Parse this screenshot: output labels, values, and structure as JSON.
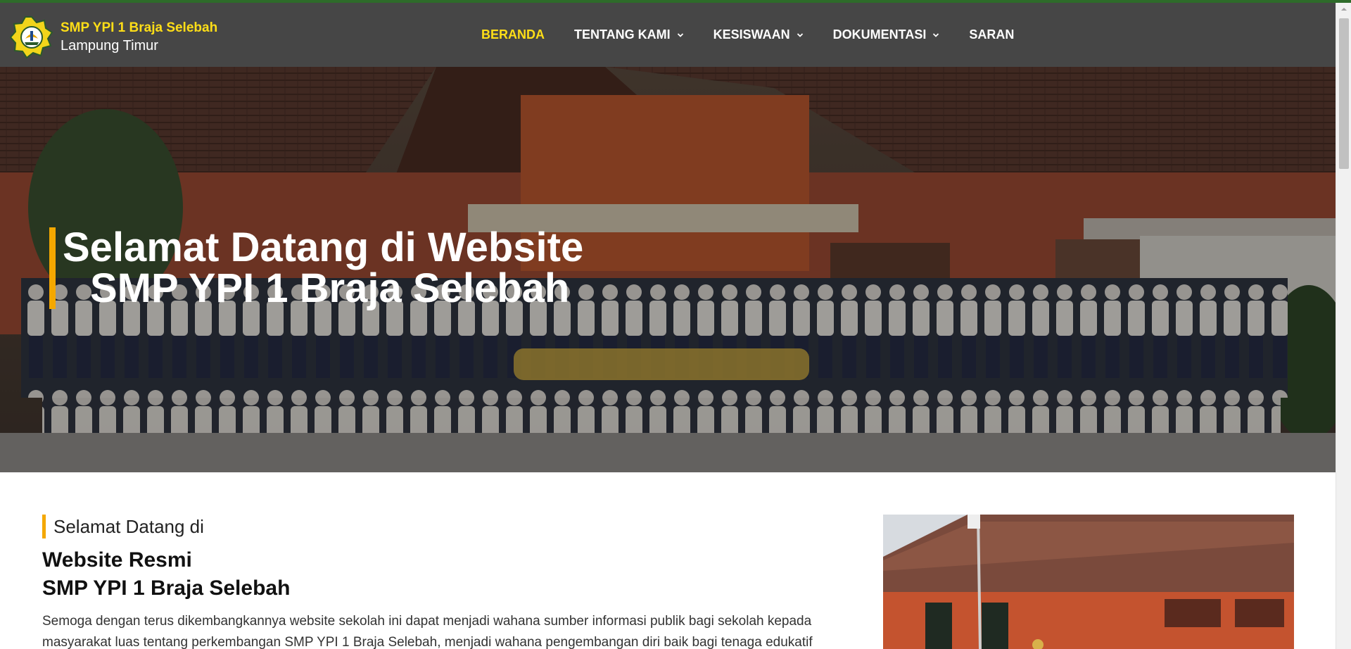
{
  "brand": {
    "name": "SMP YPI 1 Braja Selebah",
    "subtitle": "Lampung Timur",
    "logo_icon": "school-emblem-icon"
  },
  "nav": {
    "items": [
      {
        "label": "BERANDA",
        "active": true,
        "dropdown": false
      },
      {
        "label": "TENTANG KAMI",
        "active": false,
        "dropdown": true
      },
      {
        "label": "KESISWAAN",
        "active": false,
        "dropdown": true
      },
      {
        "label": "DOKUMENTASI",
        "active": false,
        "dropdown": true
      },
      {
        "label": "SARAN",
        "active": false,
        "dropdown": false
      }
    ]
  },
  "hero": {
    "line1": "Selamat Datang di Website",
    "line2": "SMP YPI 1 Braja Selebah"
  },
  "intro": {
    "kicker": "Selamat Datang di",
    "heading_line1": "Website Resmi",
    "heading_line2": "SMP YPI 1 Braja Selebah",
    "body": "Semoga dengan terus dikembangkannya website sekolah ini dapat menjadi wahana sumber informasi publik bagi sekolah kepada masyarakat luas tentang perkembangan SMP YPI 1 Braja Selebah, menjadi wahana pengembangan diri baik bagi tenaga edukatif"
  },
  "colors": {
    "navbar_bg": "#464646",
    "accent_yellow": "#ffde17",
    "accent_orange": "#f4a800",
    "top_accent": "#2e6b2a"
  }
}
